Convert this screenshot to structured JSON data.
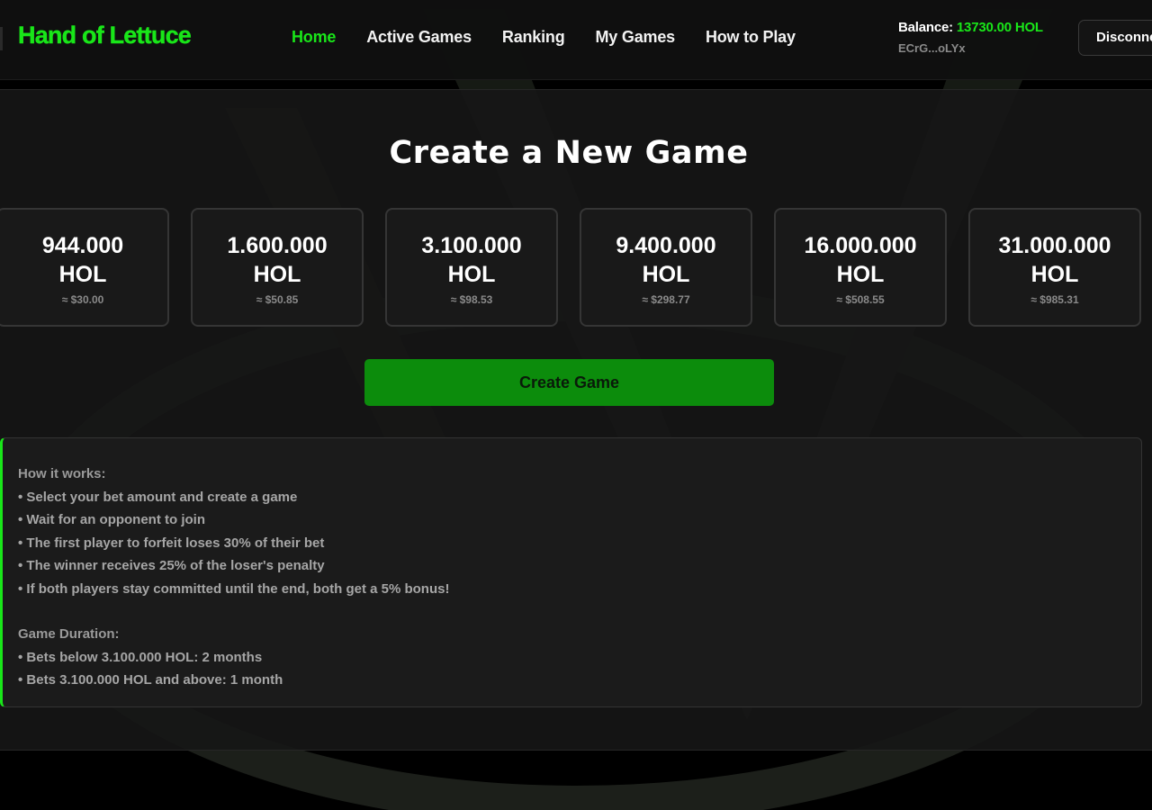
{
  "nav": {
    "brand": "Hand of Lettuce",
    "links": [
      {
        "label": "Home",
        "active": true
      },
      {
        "label": "Active Games",
        "active": false
      },
      {
        "label": "Ranking",
        "active": false
      },
      {
        "label": "My Games",
        "active": false
      },
      {
        "label": "How to Play",
        "active": false
      }
    ],
    "balance_label": "Balance:",
    "balance_value": "13730.00 HOL",
    "wallet": "ECrG...oLYx",
    "disconnect_label": "Disconnect"
  },
  "create": {
    "title": "Create a New Game",
    "bets": [
      {
        "amount": "944.000",
        "unit": "HOL",
        "usd": "≈ $30.00"
      },
      {
        "amount": "1.600.000",
        "unit": "HOL",
        "usd": "≈ $50.85"
      },
      {
        "amount": "3.100.000",
        "unit": "HOL",
        "usd": "≈ $98.53"
      },
      {
        "amount": "9.400.000",
        "unit": "HOL",
        "usd": "≈ $298.77"
      },
      {
        "amount": "16.000.000",
        "unit": "HOL",
        "usd": "≈ $508.55"
      },
      {
        "amount": "31.000.000",
        "unit": "HOL",
        "usd": "≈ $985.31"
      }
    ],
    "button_label": "Create Game"
  },
  "info": {
    "how_title": "How it works:",
    "how_items": [
      "• Select your bet amount and create a game",
      "• Wait for an opponent to join",
      "• The first player to forfeit loses 30% of their bet",
      "• The winner receives 25% of the loser's penalty",
      "• If both players stay committed until the end, both get a 5% bonus!"
    ],
    "duration_title": "Game Duration:",
    "duration_items": [
      "• Bets below 3.100.000 HOL: 2 months",
      "• Bets 3.100.000 HOL and above: 1 month"
    ]
  },
  "colors": {
    "accent": "#19e619",
    "button": "#0c8c0c",
    "background": "#000000",
    "panel": "#161616"
  }
}
